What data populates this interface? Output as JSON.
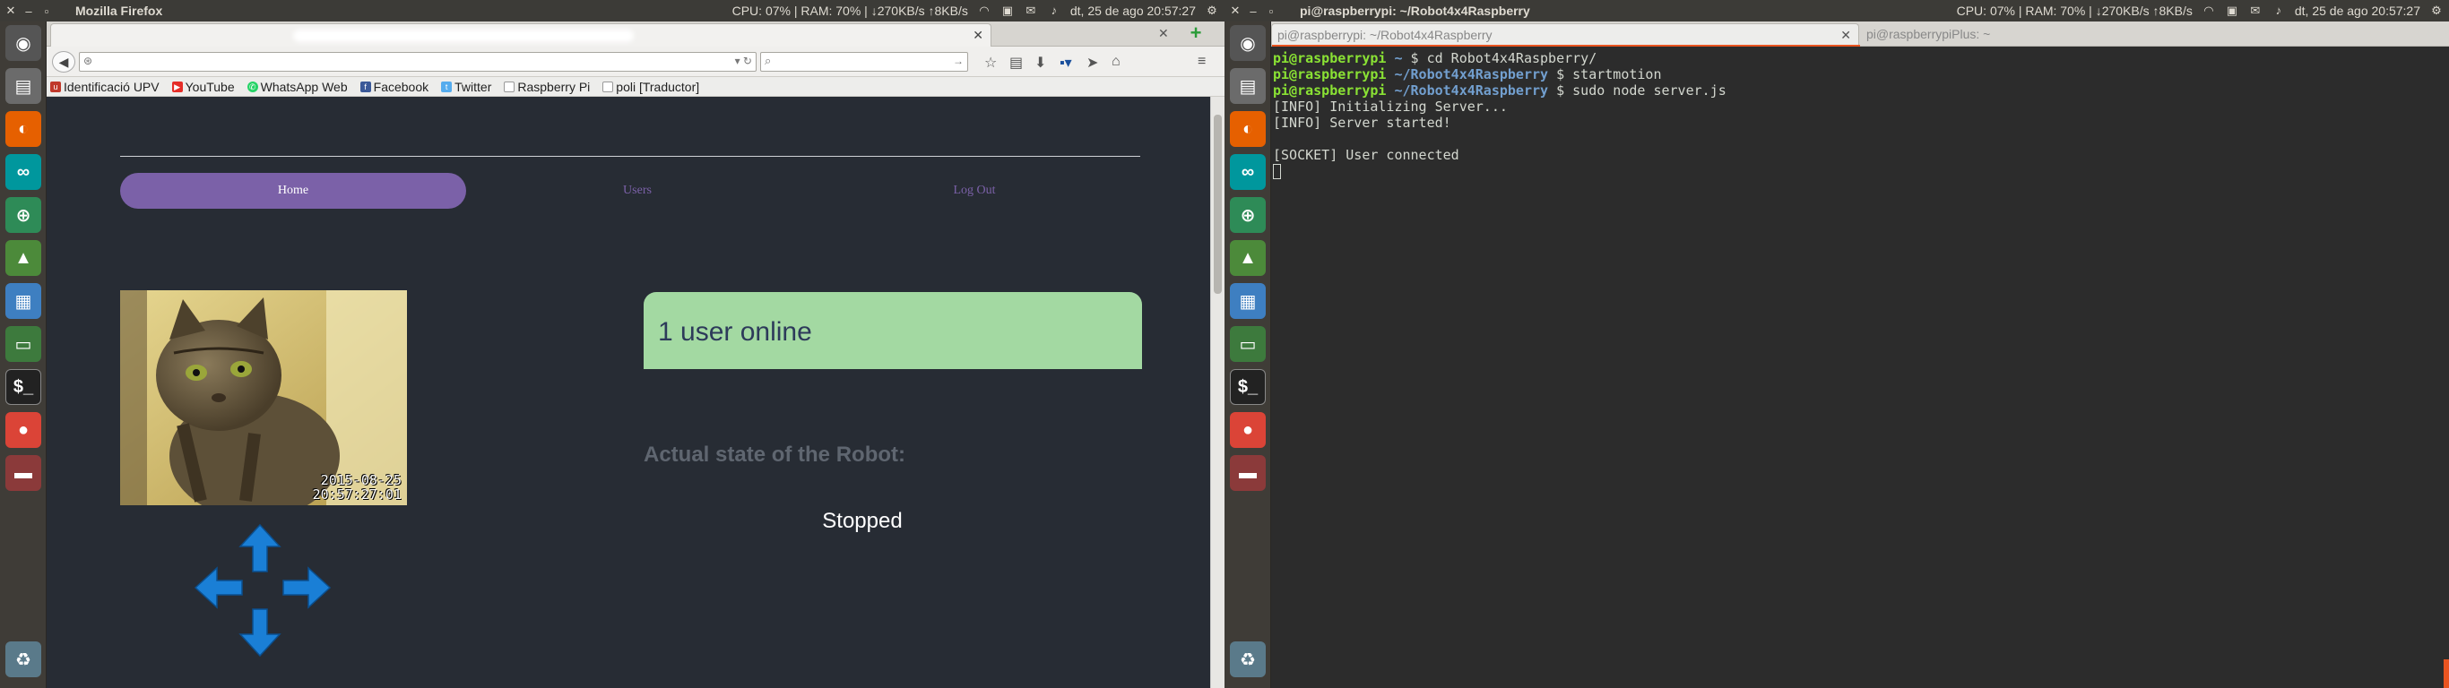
{
  "left": {
    "topbar": {
      "app_title": "Mozilla Firefox",
      "stats": "CPU: 07% | RAM: 70% | ↓270KB/s ↑8KB/s",
      "datetime": "dt, 25 de ago 20:57:27"
    },
    "bookmarks": [
      {
        "label": "Identificació UPV",
        "icon": "upv-icon",
        "color": "#c0392b"
      },
      {
        "label": "YouTube",
        "icon": "youtube-icon",
        "color": "#e52d27"
      },
      {
        "label": "WhatsApp Web",
        "icon": "whatsapp-icon",
        "color": "#25d366"
      },
      {
        "label": "Facebook",
        "icon": "facebook-icon",
        "color": "#3b5998"
      },
      {
        "label": "Twitter",
        "icon": "twitter-icon",
        "color": "#55acee"
      },
      {
        "label": "Raspberry Pi",
        "icon": "page-icon",
        "color": "#cccccc"
      },
      {
        "label": "poli [Traductor]",
        "icon": "page-icon",
        "color": "#cccccc"
      }
    ],
    "page": {
      "menu": {
        "home": "Home",
        "users": "Users",
        "logout": "Log Out"
      },
      "camera_stamp_date": "2015-08-25",
      "camera_stamp_time": "20:57:27:01",
      "online_status": "1 user online",
      "state_label": "Actual state of the Robot:",
      "state_value": "Stopped"
    },
    "colors": {
      "page_bg": "#272c34",
      "menu_accent": "#7b61a8",
      "status_green": "#a3d9a2",
      "arrow_blue": "#1a7fd6"
    }
  },
  "right": {
    "topbar": {
      "window_title": "pi@raspberrypi: ~/Robot4x4Raspberry",
      "stats": "CPU: 07% | RAM: 70% | ↓270KB/s ↑8KB/s",
      "datetime": "dt, 25 de ago 20:57:27"
    },
    "tabs": [
      {
        "label": "pi@raspberrypi: ~/Robot4x4Raspberry"
      },
      {
        "label": "pi@raspberrypiPlus: ~"
      }
    ],
    "terminal": {
      "lines": [
        {
          "user": "pi@raspberrypi",
          "path": "~",
          "cmd": "cd Robot4x4Raspberry/"
        },
        {
          "user": "pi@raspberrypi",
          "path": "~/Robot4x4Raspberry",
          "cmd": "startmotion"
        },
        {
          "user": "pi@raspberrypi",
          "path": "~/Robot4x4Raspberry",
          "cmd": "sudo node server.js"
        },
        {
          "text": "[INFO] Initializing Server..."
        },
        {
          "text": "[INFO] Server started!"
        },
        {
          "text": ""
        },
        {
          "text": "[SOCKET] User connected"
        }
      ]
    }
  }
}
